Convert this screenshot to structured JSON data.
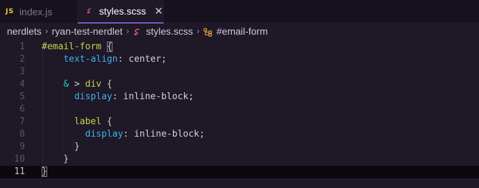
{
  "tabs": [
    {
      "label": "index.js",
      "badge": "JS",
      "active": false
    },
    {
      "label": "styles.scss",
      "active": true,
      "close_glyph": "✕"
    }
  ],
  "breadcrumb": {
    "items": [
      "nerdlets",
      "ryan-test-nerdlet",
      "styles.scss",
      "#email-form"
    ],
    "separator": "›"
  },
  "editor": {
    "active_line": 11,
    "lines": [
      {
        "n": "1",
        "tokens": [
          [
            "sel",
            "#email-form"
          ],
          [
            "punc",
            " "
          ],
          [
            "brace",
            "{"
          ]
        ]
      },
      {
        "n": "2",
        "tokens": [
          [
            "punc",
            "    "
          ],
          [
            "prop",
            "text-align"
          ],
          [
            "punc",
            ": "
          ],
          [
            "val",
            "center;"
          ]
        ]
      },
      {
        "n": "3",
        "tokens": []
      },
      {
        "n": "4",
        "tokens": [
          [
            "punc",
            "    "
          ],
          [
            "amp",
            "&"
          ],
          [
            "punc",
            " > "
          ],
          [
            "sel",
            "div"
          ],
          [
            "punc",
            " {"
          ]
        ]
      },
      {
        "n": "5",
        "tokens": [
          [
            "punc",
            "      "
          ],
          [
            "prop",
            "display"
          ],
          [
            "punc",
            ": "
          ],
          [
            "val",
            "inline-block;"
          ]
        ]
      },
      {
        "n": "6",
        "tokens": []
      },
      {
        "n": "7",
        "tokens": [
          [
            "punc",
            "      "
          ],
          [
            "sel",
            "label"
          ],
          [
            "punc",
            " {"
          ]
        ]
      },
      {
        "n": "8",
        "tokens": [
          [
            "punc",
            "        "
          ],
          [
            "prop",
            "display"
          ],
          [
            "punc",
            ": "
          ],
          [
            "val",
            "inline-block;"
          ]
        ]
      },
      {
        "n": "9",
        "tokens": [
          [
            "punc",
            "      }"
          ]
        ]
      },
      {
        "n": "10",
        "tokens": [
          [
            "punc",
            "    }"
          ]
        ]
      },
      {
        "n": "11",
        "tokens": [
          [
            "brace",
            "}"
          ]
        ]
      }
    ]
  },
  "colors": {
    "accent": "#7a5cc8",
    "selector": "#c4d74d",
    "property": "#3fb2ee",
    "ampersand": "#2ec8c0",
    "js_badge": "#e1c03e",
    "sass_icon": "#e06c8a"
  }
}
